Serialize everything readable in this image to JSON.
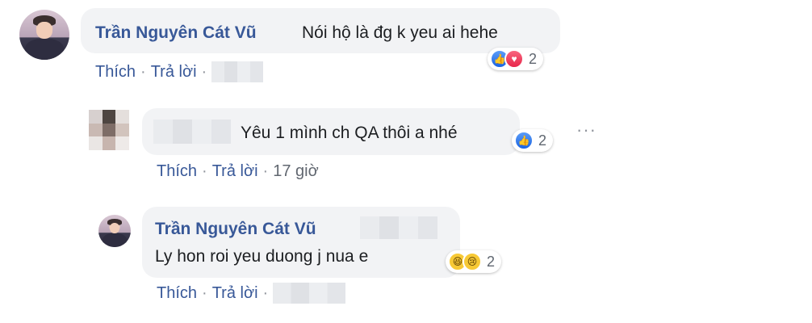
{
  "comments": [
    {
      "author": "Trần Nguyên Cát Vũ",
      "text": "Nói hộ là đg k yeu ai hehe",
      "reaction_count": "2",
      "reaction_icons": [
        "like-icon",
        "love-icon"
      ],
      "actions": {
        "like": "Thích",
        "reply": "Trả lời",
        "separator": "·"
      }
    },
    {
      "author": "",
      "text": "Yêu 1 mình ch QA thôi a nhé",
      "reaction_count": "2",
      "reaction_icons": [
        "like-icon"
      ],
      "more": "···",
      "actions": {
        "like": "Thích",
        "reply": "Trả lời",
        "separator": "·",
        "time": "17 giờ"
      }
    },
    {
      "author": "Trần Nguyên Cát Vũ",
      "text": "Ly hon roi yeu duong j nua e",
      "reaction_count": "2",
      "reaction_icons": [
        "haha-icon",
        "sad-icon"
      ],
      "actions": {
        "like": "Thích",
        "reply": "Trả lời",
        "separator": "·"
      }
    }
  ],
  "colors": {
    "author": "#385898",
    "bubble": "#f2f3f5",
    "like": "#1a64e2",
    "love": "#e8264a",
    "haha": "#f7c935"
  }
}
